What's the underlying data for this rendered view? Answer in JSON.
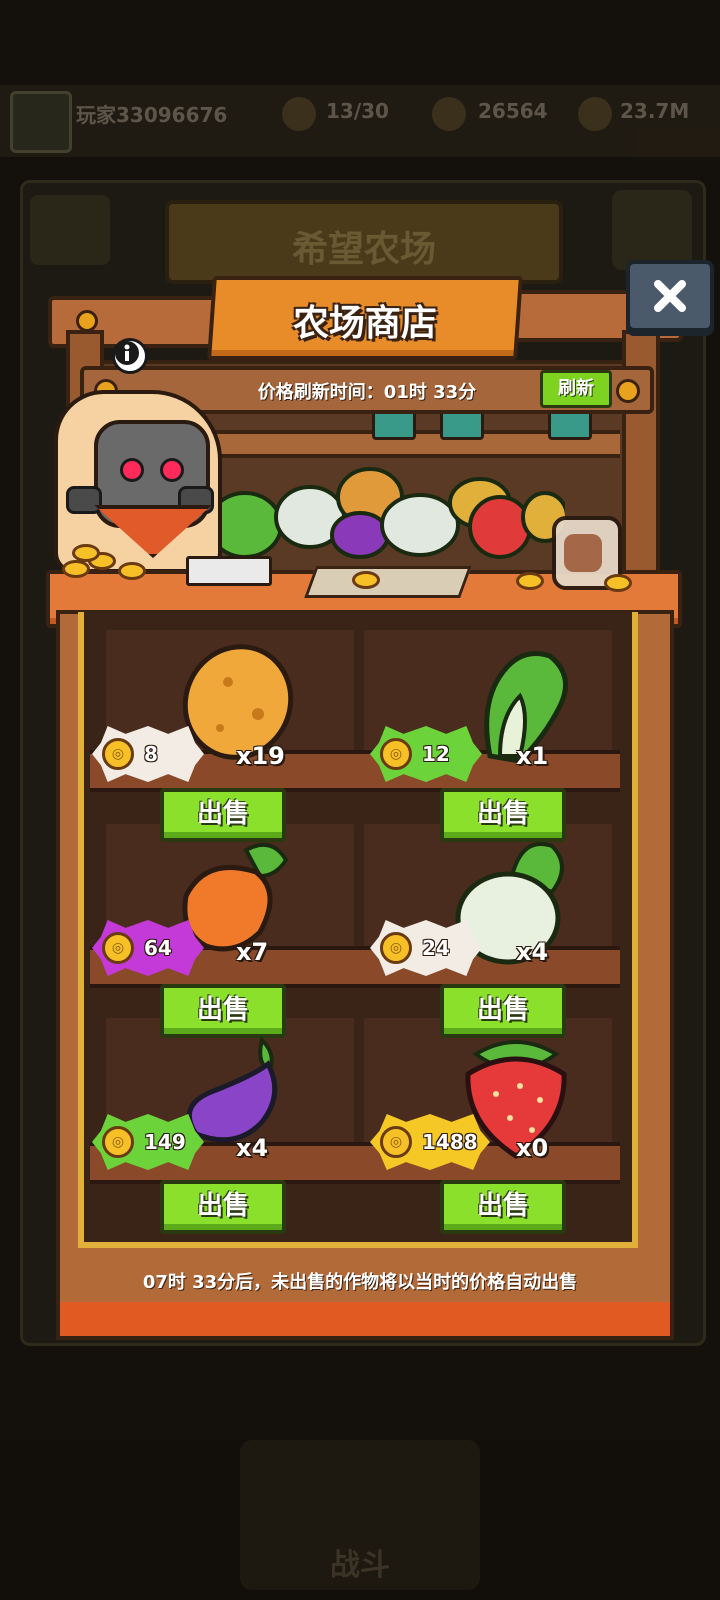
{
  "hud": {
    "player_name": "玩家33096676",
    "level_text": "13/30",
    "gold": "26564",
    "power": "23.7M"
  },
  "background": {
    "farm_title": "希望农场",
    "battle_label": "战斗"
  },
  "shop": {
    "title": "农场商店",
    "refresh_time": "价格刷新时间：01时 33分",
    "refresh_button": "刷新",
    "auto_sell_notice": "07时 33分后，未出售的作物将以当时的价格自动出售",
    "sell_label": "出售",
    "items": [
      {
        "name": "potato",
        "price": "8",
        "quantity": "x19",
        "tag_color": "#f2ece4"
      },
      {
        "name": "cabbage",
        "price": "12",
        "quantity": "x1",
        "tag_color": "#6cd33a"
      },
      {
        "name": "carrot",
        "price": "64",
        "quantity": "x7",
        "tag_color": "#c43ad8"
      },
      {
        "name": "turnip",
        "price": "24",
        "quantity": "x4",
        "tag_color": "#f2ece4"
      },
      {
        "name": "eggplant",
        "price": "149",
        "quantity": "x4",
        "tag_color": "#6cd33a"
      },
      {
        "name": "strawberry",
        "price": "1488",
        "quantity": "x0",
        "tag_color": "#f6c826"
      }
    ]
  },
  "icons": {
    "close": "close-icon",
    "info": "info-icon",
    "coin": "coin-icon"
  }
}
